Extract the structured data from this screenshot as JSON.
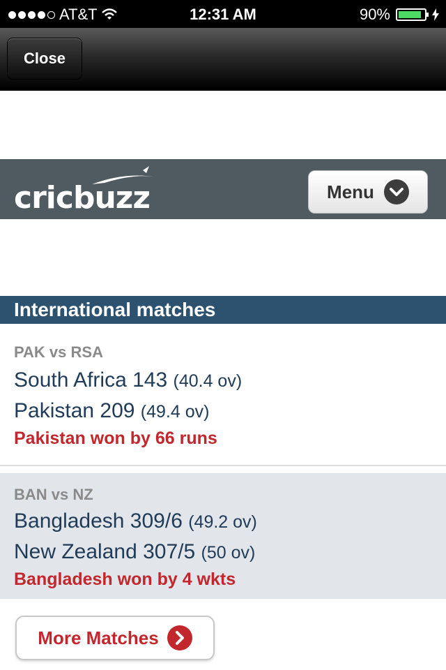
{
  "status_bar": {
    "carrier": "AT&T",
    "time": "12:31 AM",
    "battery_percent": "90%",
    "signal_bars": 4,
    "battery_level": 0.9
  },
  "nav": {
    "close_label": "Close"
  },
  "header": {
    "logo_text": "cricbuzz",
    "menu_label": "Menu"
  },
  "section": {
    "title": "International matches"
  },
  "matches": [
    {
      "fixture": "PAK vs RSA",
      "innings": [
        {
          "team_score": "South Africa 143",
          "overs": "(40.4 ov)"
        },
        {
          "team_score": "Pakistan 209",
          "overs": "(49.4 ov)"
        }
      ],
      "result": "Pakistan won by 66 runs"
    },
    {
      "fixture": "BAN vs NZ",
      "innings": [
        {
          "team_score": "Bangladesh 309/6",
          "overs": "(49.2 ov)"
        },
        {
          "team_score": "New Zealand 307/5",
          "overs": "(50 ov)"
        }
      ],
      "result": "Bangladesh won by 4 wkts"
    }
  ],
  "more_matches_label": "More Matches",
  "colors": {
    "section_bg": "#2c5270",
    "result_red": "#c1272d",
    "score_blue": "#1f3b57",
    "header_bg": "#4f5b61"
  }
}
